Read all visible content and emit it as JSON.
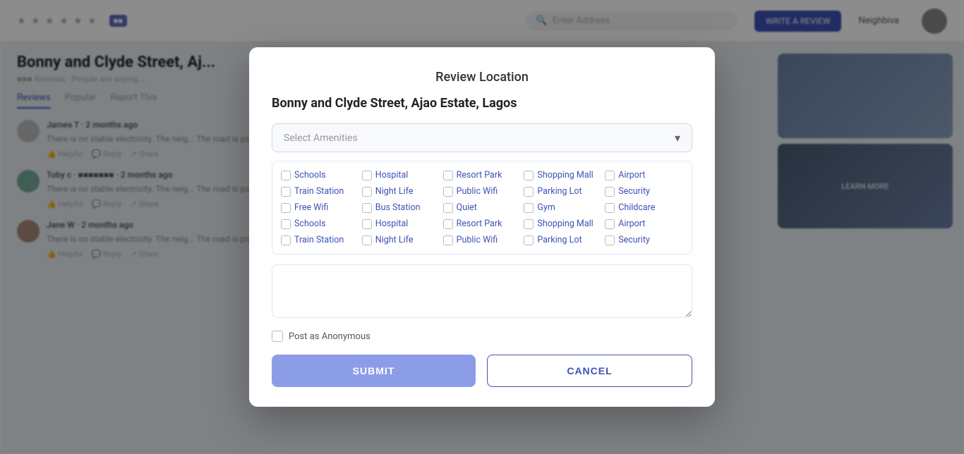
{
  "background": {
    "stars": "★ ★ ★ ★ ★ ★",
    "badge": "■■",
    "search_placeholder": "Enter Address",
    "username": "Neighbiva",
    "title": "Bonny and Clyde Street, Aj...",
    "subtitle": "■■■ Reviews · People are saying...",
    "tabs": [
      "Reviews",
      "Popular",
      "Report This"
    ],
    "btn_review": "WRITE A REVIEW"
  },
  "modal": {
    "title": "Review Location",
    "location": "Bonny and Clyde Street, Ajao Estate, Lagos",
    "select_placeholder": "Select Amenities",
    "amenities": [
      "Schools",
      "Hospital",
      "Resort Park",
      "Shopping Mall",
      "Airport",
      "Train Station",
      "Night Life",
      "Public Wifi",
      "Parking Lot",
      "Security",
      "Free Wifi",
      "Bus Station",
      "Quiet",
      "Gym",
      "Childcare",
      "Schools",
      "Hospital",
      "Resort Park",
      "Shopping Mall",
      "Airport",
      "Train Station",
      "Night Life",
      "Public Wifi",
      "Parking Lot",
      "Security"
    ],
    "textarea_placeholder": "",
    "anonymous_label": "Post as Anonymous",
    "submit_label": "SUBMIT",
    "cancel_label": "CANCEL",
    "close_icon": "✕"
  }
}
